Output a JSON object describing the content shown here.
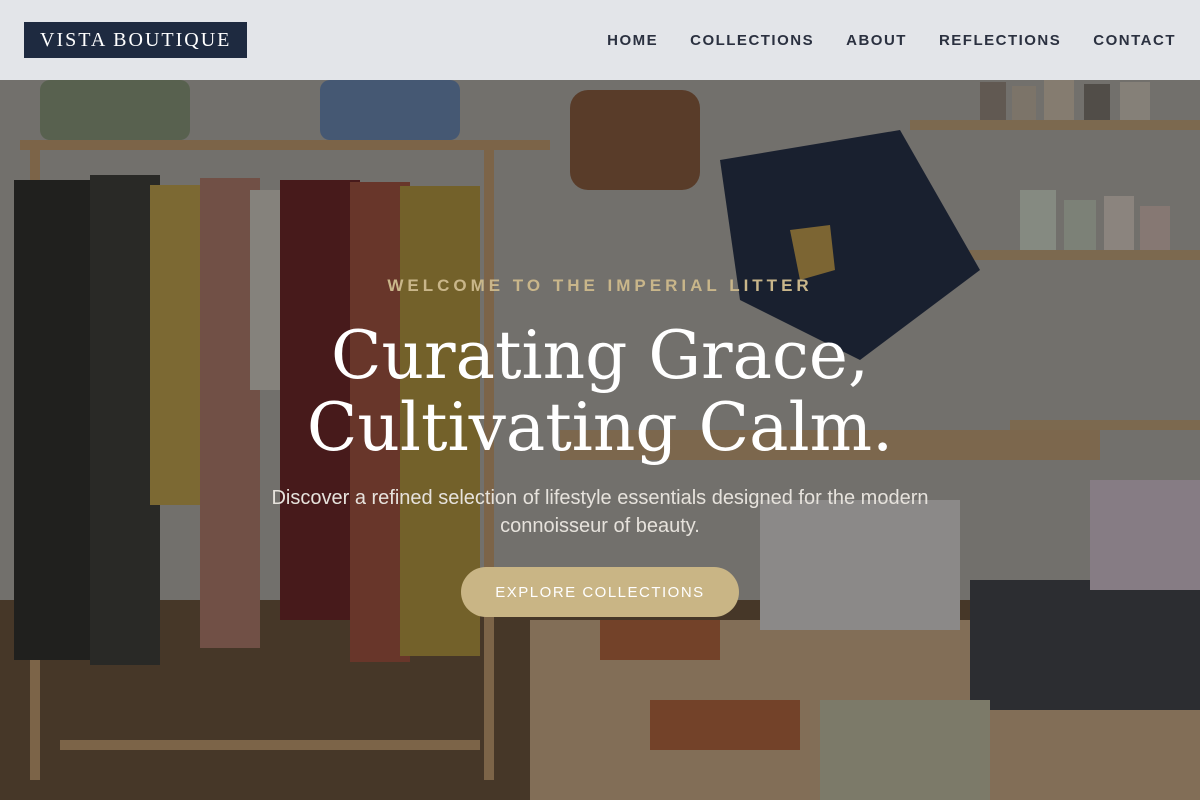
{
  "brand": {
    "logo_text": "VISTA BOUTIQUE",
    "logo_bg": "#1e2a40"
  },
  "nav": {
    "items": [
      {
        "label": "HOME"
      },
      {
        "label": "COLLECTIONS"
      },
      {
        "label": "ABOUT"
      },
      {
        "label": "REFLECTIONS"
      },
      {
        "label": "CONTACT"
      }
    ]
  },
  "hero": {
    "eyebrow": "WELCOME TO THE IMPERIAL LITTER",
    "headline_line1": "Curating Grace,",
    "headline_line2": "Cultivating Calm.",
    "subcopy": "Discover a refined selection of lifestyle essentials designed for the modern connoisseur of beauty.",
    "cta_label": "EXPLORE COLLECTIONS",
    "accent_color": "#c9b585"
  }
}
